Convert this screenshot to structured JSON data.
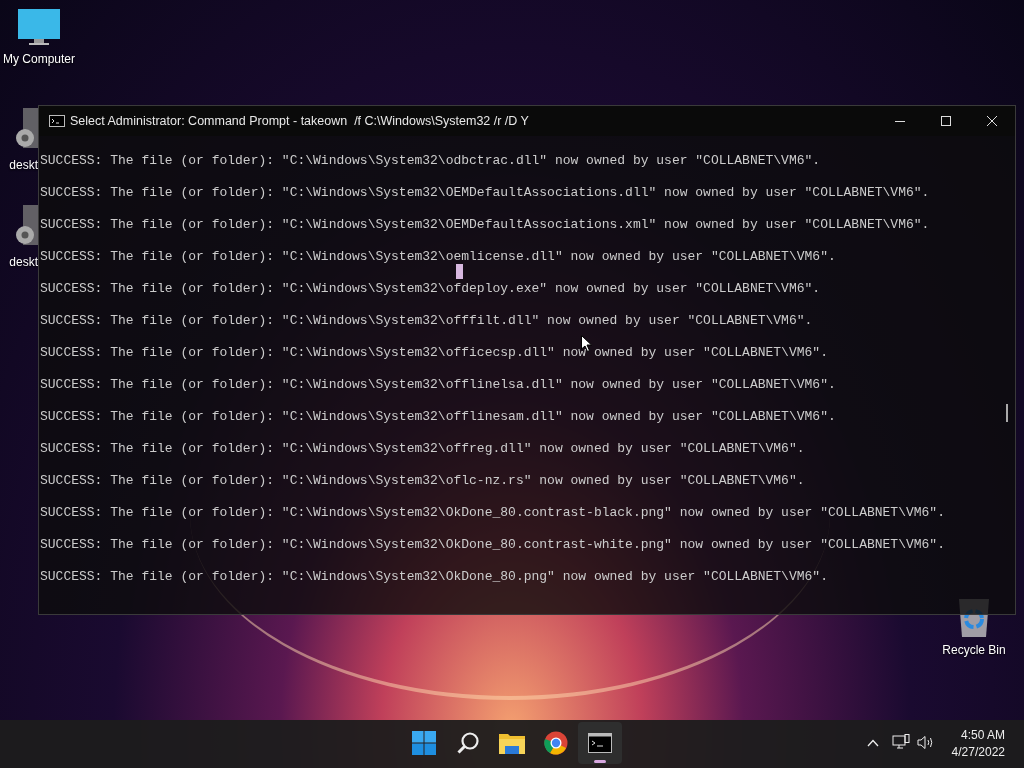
{
  "desktop_icons": [
    {
      "kind": "computer",
      "label": "My Computer"
    },
    {
      "kind": "settings-file",
      "label": "deskt"
    },
    {
      "kind": "settings-file",
      "label": "deskt"
    },
    {
      "kind": "recycle",
      "label": "Recycle Bin"
    }
  ],
  "window": {
    "title": "Select Administrator: Command Prompt - takeown  /f C:\\Windows\\System32 /r /D Y",
    "lines": [
      "SUCCESS: The file (or folder): \"C:\\Windows\\System32\\odbctrac.dll\" now owned by user \"COLLABNET\\VM6\".",
      "SUCCESS: The file (or folder): \"C:\\Windows\\System32\\OEMDefaultAssociations.dll\" now owned by user \"COLLABNET\\VM6\".",
      "SUCCESS: The file (or folder): \"C:\\Windows\\System32\\OEMDefaultAssociations.xml\" now owned by user \"COLLABNET\\VM6\".",
      "SUCCESS: The file (or folder): \"C:\\Windows\\System32\\oemlicense.dll\" now owned by user \"COLLABNET\\VM6\".",
      "SUCCESS: The file (or folder): \"C:\\Windows\\System32\\ofdeploy.exe\" now owned by user \"COLLABNET\\VM6\".",
      "SUCCESS: The file (or folder): \"C:\\Windows\\System32\\offfilt.dll\" now owned by user \"COLLABNET\\VM6\".",
      "SUCCESS: The file (or folder): \"C:\\Windows\\System32\\officecsp.dll\" now owned by user \"COLLABNET\\VM6\".",
      "SUCCESS: The file (or folder): \"C:\\Windows\\System32\\offlinelsa.dll\" now owned by user \"COLLABNET\\VM6\".",
      "SUCCESS: The file (or folder): \"C:\\Windows\\System32\\offlinesam.dll\" now owned by user \"COLLABNET\\VM6\".",
      "SUCCESS: The file (or folder): \"C:\\Windows\\System32\\offreg.dll\" now owned by user \"COLLABNET\\VM6\".",
      "SUCCESS: The file (or folder): \"C:\\Windows\\System32\\oflc-nz.rs\" now owned by user \"COLLABNET\\VM6\".",
      "SUCCESS: The file (or folder): \"C:\\Windows\\System32\\OkDone_80.contrast-black.png\" now owned by user \"COLLABNET\\VM6\".",
      "SUCCESS: The file (or folder): \"C:\\Windows\\System32\\OkDone_80.contrast-white.png\" now owned by user \"COLLABNET\\VM6\".",
      "SUCCESS: The file (or folder): \"C:\\Windows\\System32\\OkDone_80.png\" now owned by user \"COLLABNET\\VM6\"."
    ]
  },
  "taskbar": {
    "apps": [
      {
        "kind": "start",
        "selected": false
      },
      {
        "kind": "search",
        "selected": false
      },
      {
        "kind": "explorer",
        "selected": false
      },
      {
        "kind": "browser",
        "selected": false
      },
      {
        "kind": "terminal",
        "selected": true
      }
    ],
    "time": "4:50 AM",
    "date": "4/27/2022"
  }
}
